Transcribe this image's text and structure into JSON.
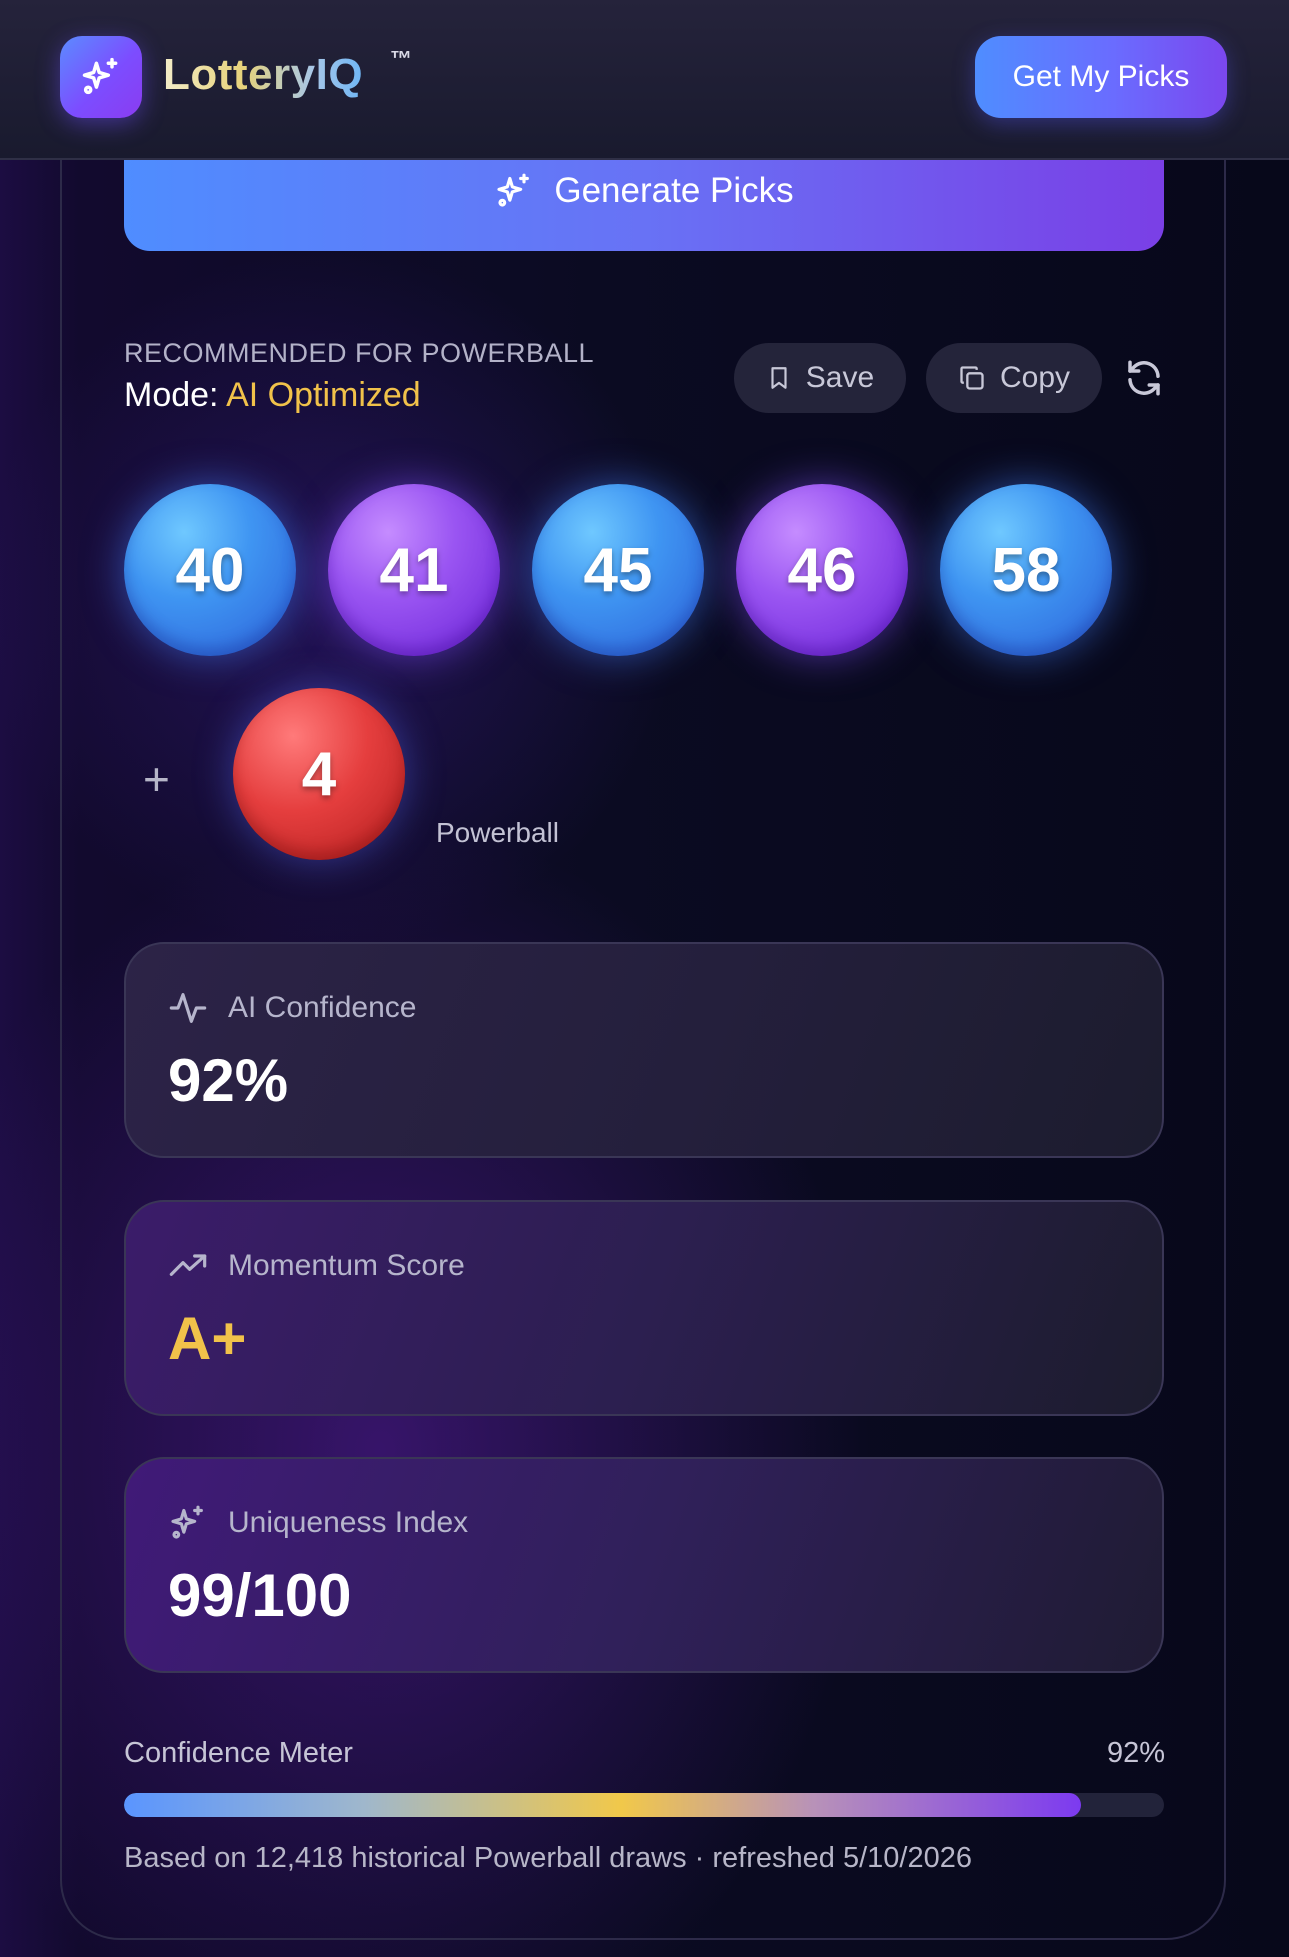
{
  "header": {
    "brand": "LotteryIQ",
    "trademark": "™",
    "cta_label": "Get My Picks",
    "logo_icon": "sparkles-icon"
  },
  "generate": {
    "label": "Generate Picks",
    "icon": "sparkles-icon"
  },
  "recommendation": {
    "heading": "RECOMMENDED FOR POWERBALL",
    "mode_prefix": "Mode: ",
    "mode_value": "AI Optimized",
    "save_label": "Save",
    "copy_label": "Copy"
  },
  "picks": {
    "main_numbers": [
      "40",
      "41",
      "45",
      "46",
      "58"
    ],
    "plus": "+",
    "powerball_number": "4",
    "powerball_label": "Powerball"
  },
  "stats": [
    {
      "label": "AI Confidence",
      "value": "92%",
      "icon": "activity-pulse-icon"
    },
    {
      "label": "Momentum Score",
      "value": "A+",
      "icon": "trending-up-icon"
    },
    {
      "label": "Uniqueness Index",
      "value": "99/100",
      "icon": "sparkles-icon"
    }
  ],
  "meter": {
    "label": "Confidence Meter",
    "percent_text": "92%",
    "fraction": 0.92,
    "footnote": "Based on 12,418 historical Powerball draws · refreshed 5/10/2026"
  },
  "colors": {
    "accent_gold": "#f1c24a",
    "ball_blue": "#3f95f2",
    "ball_purple": "#9a55f2",
    "ball_red": "#e53e3e"
  }
}
